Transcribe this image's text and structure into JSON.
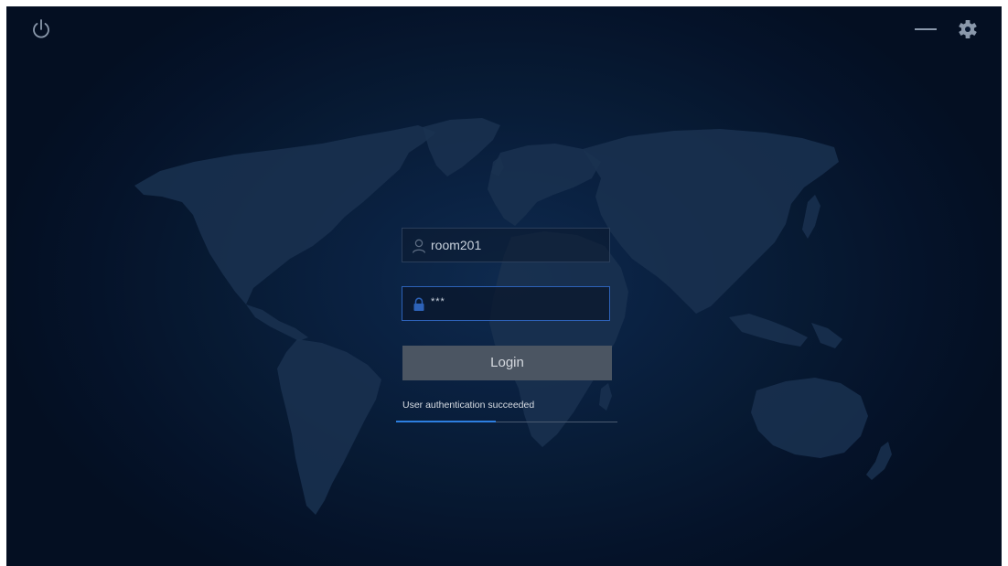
{
  "window": {
    "icons": {
      "power": "power-icon",
      "minimize": "minimize-icon",
      "settings": "gear-icon"
    }
  },
  "login": {
    "username": {
      "icon": "user-icon",
      "value": "room201"
    },
    "password": {
      "icon": "lock-icon",
      "value": "***"
    },
    "button_label": "Login",
    "status_text": "User authentication succeeded",
    "progress": 0.45
  },
  "colors": {
    "background": "#071a33",
    "accent": "#2d7fe0",
    "button_bg": "#4b5562",
    "active_border": "#2d62b8"
  }
}
